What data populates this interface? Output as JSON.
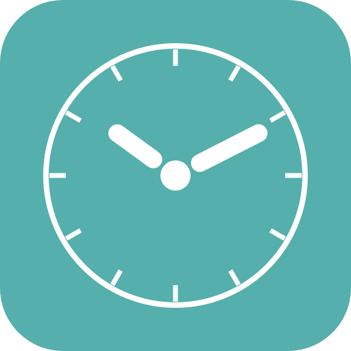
{
  "app_icon": {
    "name": "clock-icon",
    "colors": {
      "background": "#55afac",
      "foreground": "#ffffff"
    }
  },
  "clock": {
    "hours": 10,
    "minutes": 10,
    "tick_count": 12
  }
}
